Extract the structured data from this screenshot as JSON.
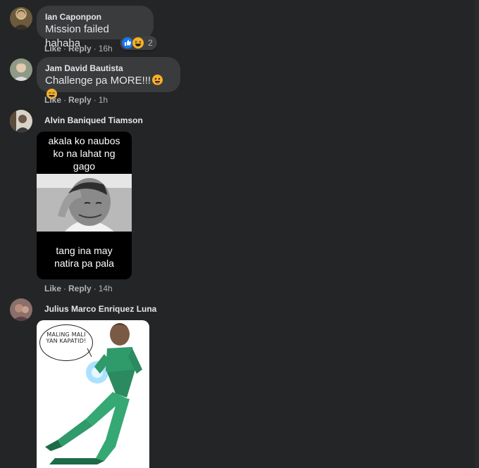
{
  "comments": [
    {
      "author": "Ian Caponpon",
      "text": "Mission failed hahaha",
      "like_label": "Like",
      "reply_label": "Reply",
      "time": "16h",
      "reaction_count": "2"
    },
    {
      "author": "Jam David Bautista",
      "text": "Challenge pa MORE!!!",
      "like_label": "Like",
      "reply_label": "Reply",
      "time": "1h"
    },
    {
      "author": "Alvin Baniqued Tiamson",
      "image_caption_top": "akala ko naubos ko na lahat ng gago",
      "image_caption_bottom": "tang ina may natira pa pala",
      "like_label": "Like",
      "reply_label": "Reply",
      "time": "14h"
    },
    {
      "author": "Julius Marco Enriquez Luna",
      "image_speech": "MALING MALI YAN KAPATID!"
    }
  ],
  "icons": {
    "reactions": [
      "like-icon",
      "haha-icon"
    ],
    "emojis": [
      "tongue-out-emoji",
      "grin-sweat-emoji"
    ]
  },
  "colors": {
    "background": "#242526",
    "bubble": "#3a3b3c",
    "text": "#e4e6eb",
    "secondary_text": "#b0b3b8",
    "like_blue": "#1877f2",
    "emoji_yellow": "#f7b125"
  }
}
